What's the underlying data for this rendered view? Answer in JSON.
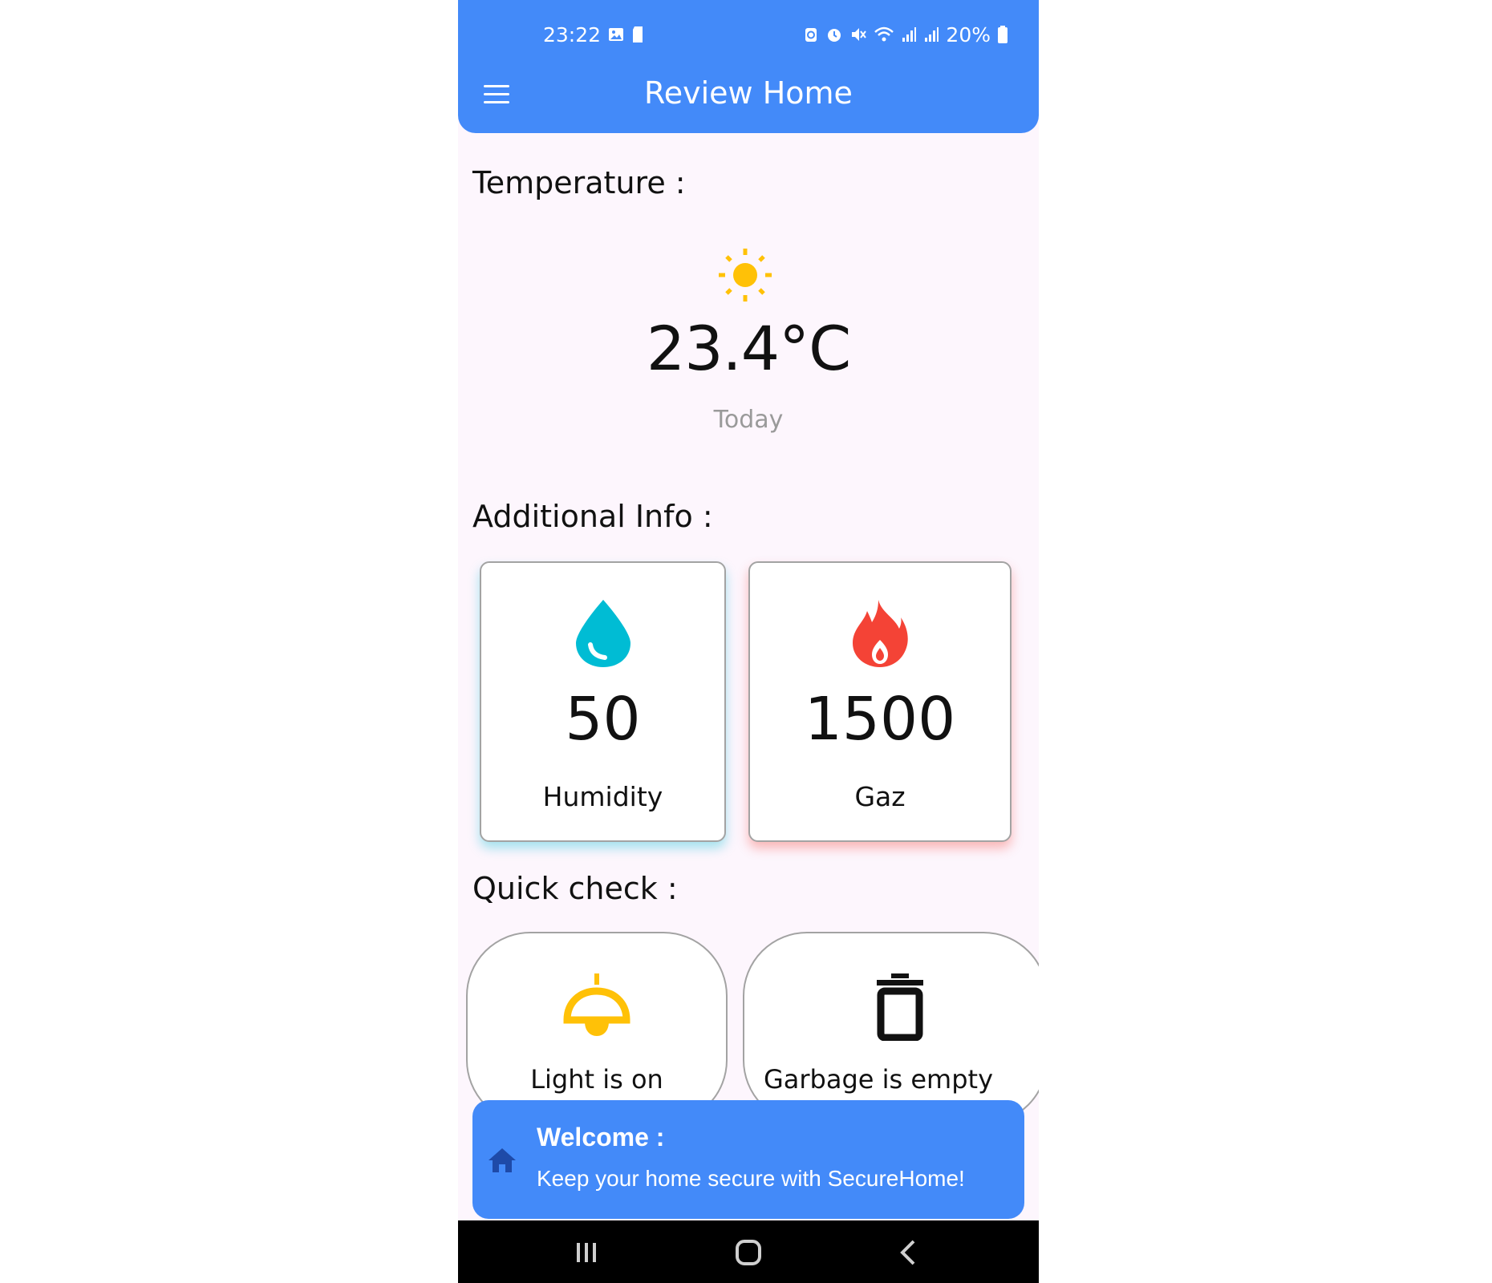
{
  "status_bar": {
    "time": "23:22",
    "battery": "20%",
    "icons_left": [
      "gallery-icon",
      "sd-card-icon"
    ],
    "icons_right": [
      "data-saver-icon",
      "alarm-icon",
      "mute-icon",
      "wifi-icon",
      "signal-icon",
      "signal-icon",
      "battery-icon"
    ]
  },
  "app_bar": {
    "title": "Review Home",
    "menu_icon": "hamburger-menu-icon"
  },
  "temperature": {
    "heading": "Temperature :",
    "icon": "sun-icon",
    "value": "23.4°C",
    "subtitle": "Today"
  },
  "additional_info": {
    "heading": "Additional Info :",
    "cards": [
      {
        "icon": "water-drop-icon",
        "value": "50",
        "label": "Humidity",
        "accent": "#00bcd4"
      },
      {
        "icon": "flame-icon",
        "value": "1500",
        "label": "Gaz",
        "accent": "#f44336"
      }
    ]
  },
  "quick_check": {
    "heading": "Quick check :",
    "items": [
      {
        "icon": "ceiling-lamp-icon",
        "label": "Light is on",
        "color": "#ffc107"
      },
      {
        "icon": "trash-icon",
        "label": "Garbage is empty",
        "color": "#000000"
      }
    ]
  },
  "toast": {
    "icon": "home-icon",
    "title": "Welcome :",
    "message": "Keep your home secure with SecureHome!"
  },
  "nav_bar": {
    "buttons": [
      "recent-apps-icon",
      "home-icon",
      "back-icon"
    ]
  },
  "colors": {
    "primary": "#438af9",
    "background": "#fdf6fd",
    "humidity": "#00bcd4",
    "gaz": "#f44336",
    "light": "#ffc107"
  }
}
